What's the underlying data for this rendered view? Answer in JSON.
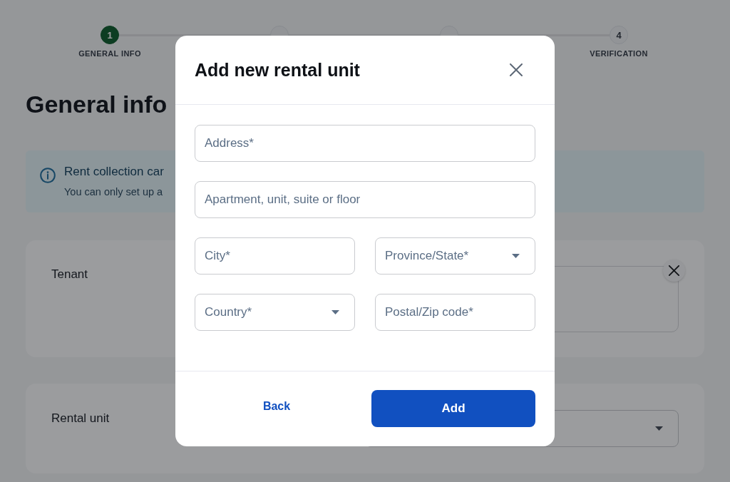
{
  "stepper": {
    "steps": [
      {
        "number": "1",
        "label": "GENERAL INFO",
        "selected": true
      },
      {
        "selected": false
      },
      {
        "selected": false
      },
      {
        "number": "4",
        "label": "VERIFICATION",
        "selected": false
      }
    ]
  },
  "page": {
    "title": "General info",
    "notice": {
      "title": "Rent collection car",
      "text": "You can only set up a"
    },
    "sections": [
      {
        "kind": "entry",
        "label": "Tenant"
      },
      {
        "kind": "select",
        "label": "Rental unit"
      }
    ]
  },
  "dialog": {
    "title": "Add new rental unit",
    "rows": [
      [
        {
          "kind": "text",
          "placeholder": "Address*"
        }
      ],
      [
        {
          "kind": "text",
          "placeholder": "Apartment, unit, suite or floor"
        }
      ],
      [
        {
          "kind": "text",
          "placeholder": "City*"
        },
        {
          "kind": "select",
          "placeholder": "Province/State*"
        }
      ],
      [
        {
          "kind": "select",
          "placeholder": "Country*"
        },
        {
          "kind": "text",
          "placeholder": "Postal/Zip code*"
        }
      ]
    ],
    "buttons": [
      {
        "kind": "link",
        "label": "Back"
      },
      {
        "kind": "primary",
        "label": "Add"
      }
    ]
  }
}
